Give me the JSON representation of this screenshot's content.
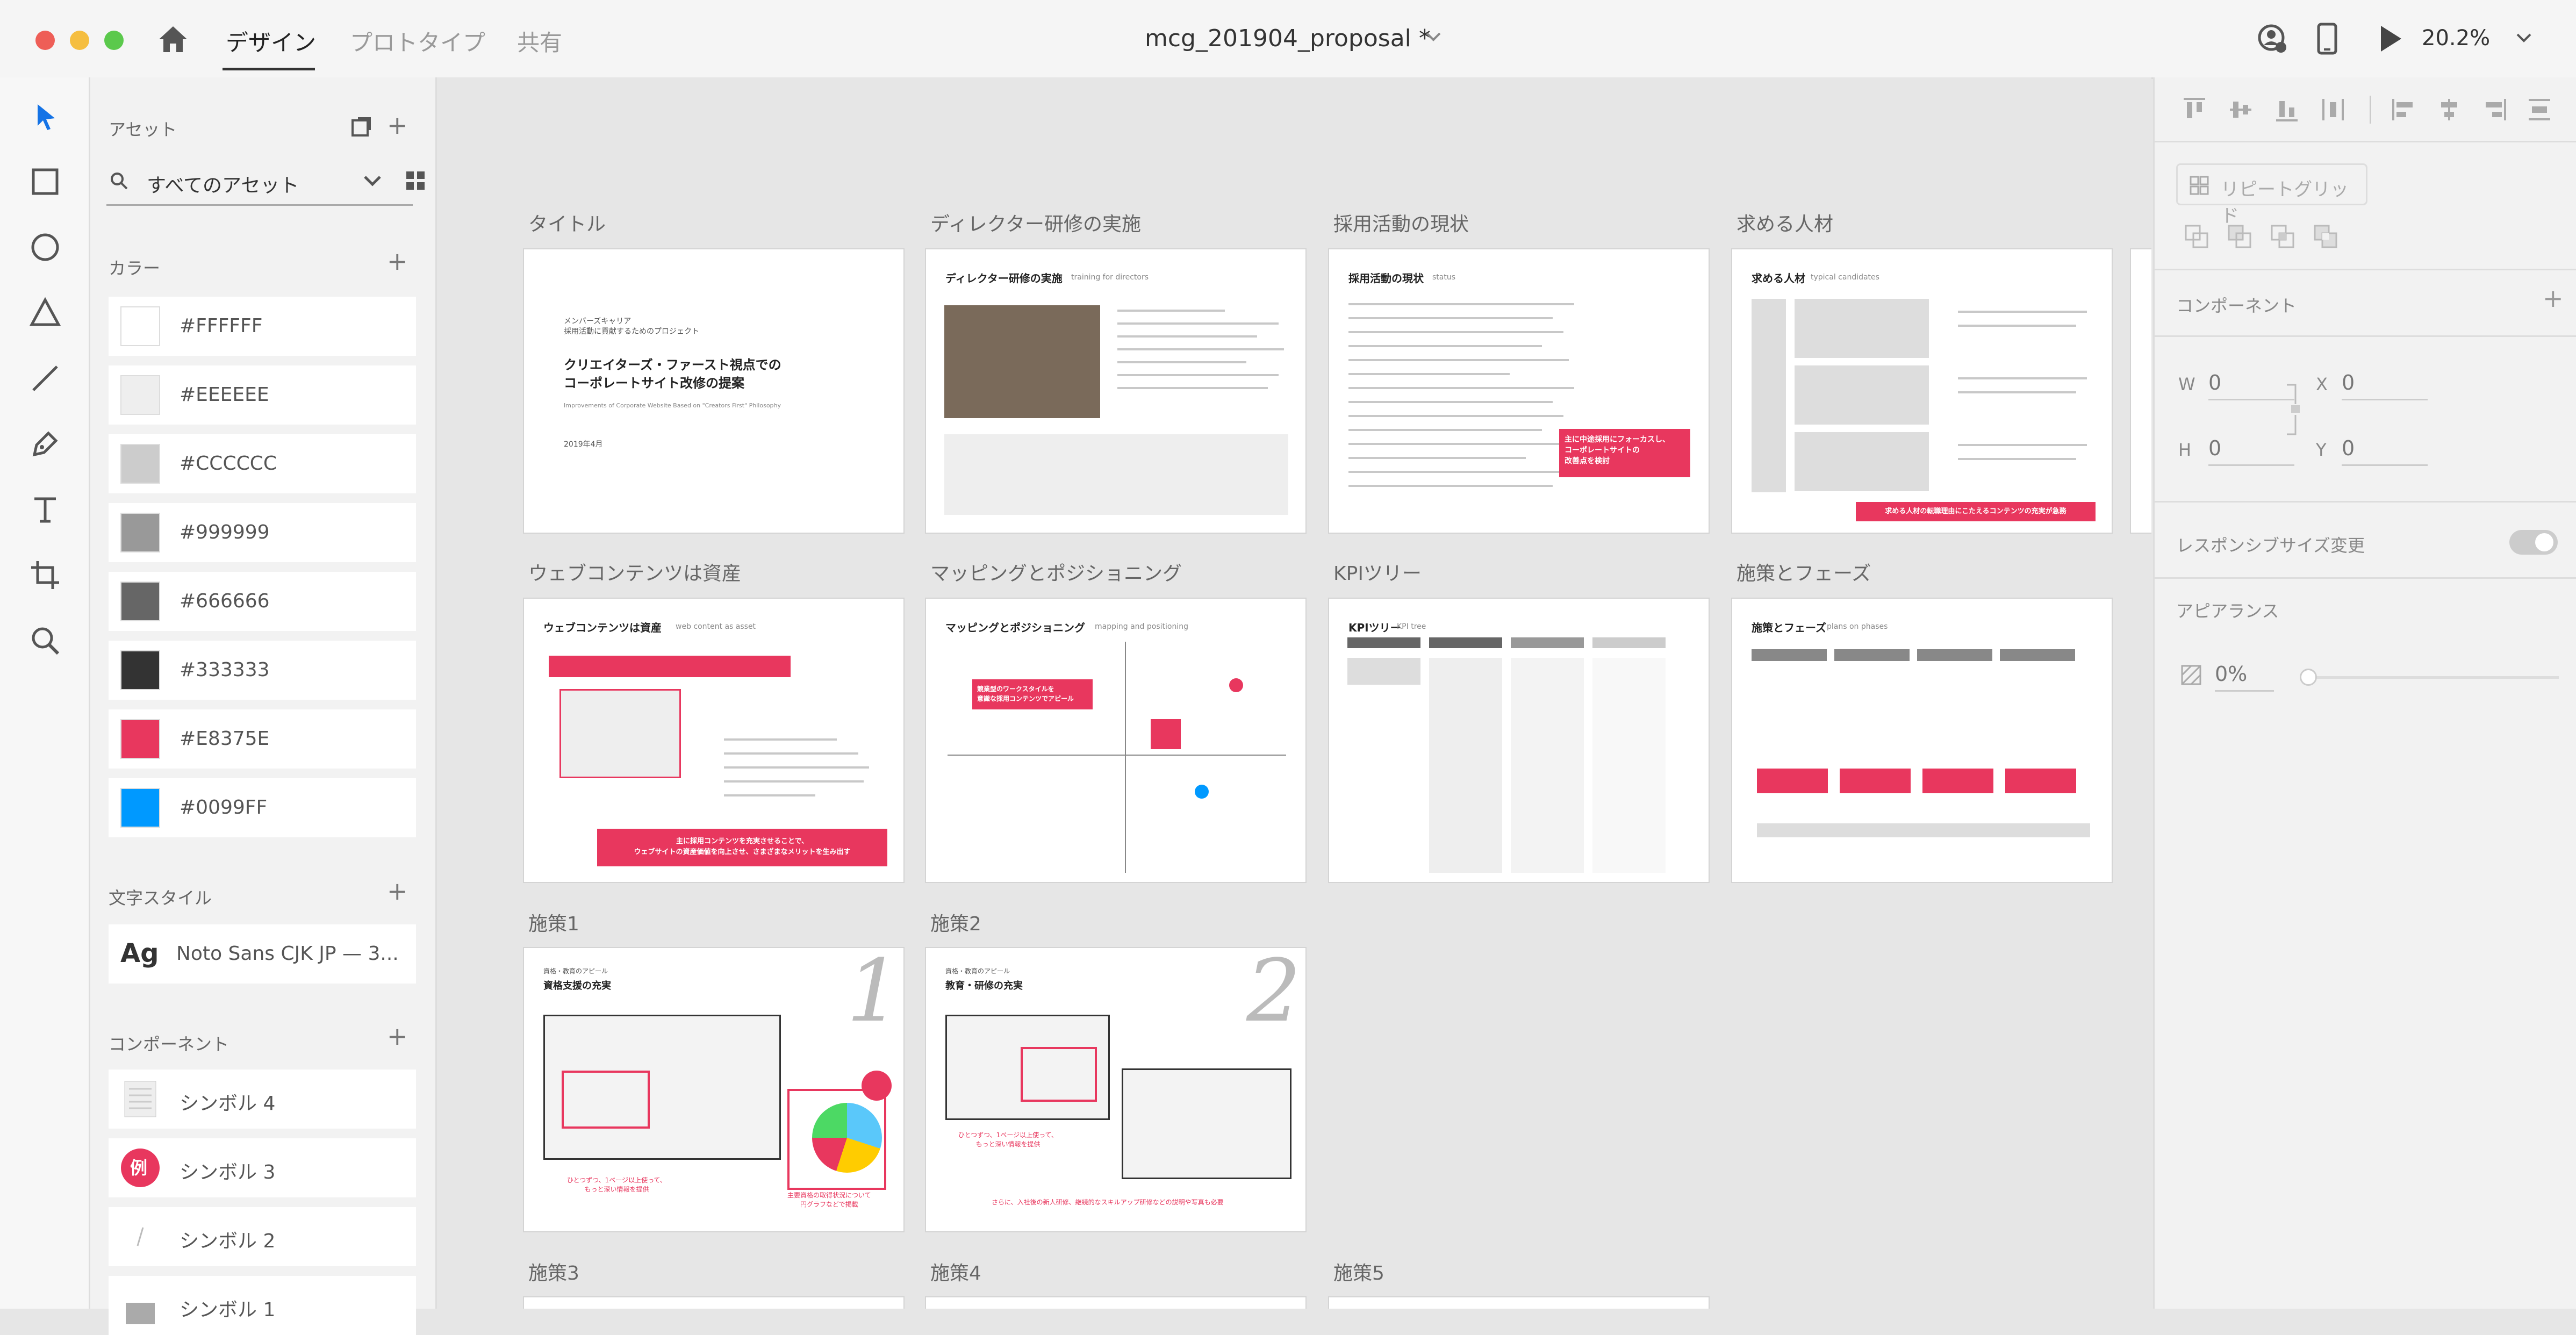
{
  "titlebar": {
    "tabs": {
      "design": "デザイン",
      "prototype": "プロトタイプ",
      "share": "共有"
    },
    "doc_title": "mcg_201904_proposal *",
    "zoom": "20.2%"
  },
  "assets": {
    "title": "アセット",
    "search": "すべてのアセット",
    "colors_title": "カラー",
    "colors": [
      {
        "hex": "#FFFFFF",
        "label": "#FFFFFF"
      },
      {
        "hex": "#EEEEEE",
        "label": "#EEEEEE"
      },
      {
        "hex": "#CCCCCC",
        "label": "#CCCCCC"
      },
      {
        "hex": "#999999",
        "label": "#999999"
      },
      {
        "hex": "#666666",
        "label": "#666666"
      },
      {
        "hex": "#333333",
        "label": "#333333"
      },
      {
        "hex": "#E8375E",
        "label": "#E8375E"
      },
      {
        "hex": "#0099FF",
        "label": "#0099FF"
      }
    ],
    "char_styles_title": "文字スタイル",
    "char_style": {
      "sample": "Ag",
      "label": "Noto Sans CJK JP — 3..."
    },
    "components_title": "コンポーネント",
    "components": [
      "シンボル 4",
      "シンボル 3",
      "シンボル 2",
      "シンボル 1"
    ],
    "symbol3_badge": "例"
  },
  "artboards": [
    {
      "label": "タイトル",
      "heading": "クリエイターズ・ファースト視点での\nコーポレートサイト改修の提案",
      "pre": "メンバーズキャリア\n採用活動に貢献するためのプロジェクト",
      "sub": "Improvements of Corporate Website Based on \"Creators First\" Philosophy",
      "date": "2019年4月"
    },
    {
      "label": "ディレクター研修の実施",
      "heading": "ディレクター研修の実施",
      "sub": "training for directors"
    },
    {
      "label": "採用活動の現状",
      "heading": "採用活動の現状",
      "sub": "status",
      "callout": "主に中途採用にフォーカスし、\nコーポレートサイトの\n改善点を検討"
    },
    {
      "label": "求める人材",
      "heading": "求める人材",
      "sub": "typical candidates",
      "footer": "求める人材の転職理由にこたえるコンテンツの充実が急務"
    },
    {
      "label": "ウェブコンテンツは資産",
      "heading": "ウェブコンテンツは資産",
      "sub": "web content as asset",
      "footer": "主に採用コンテンツを充実させることで、\nウェブサイトの資産価値を向上させ、さまざまなメリットを生み出す"
    },
    {
      "label": "マッピングとポジショニング",
      "heading": "マッピングとポジショニング",
      "sub": "mapping and positioning",
      "callout": "競業型のワークスタイルを\n意識な採用コンテンツでアピール"
    },
    {
      "label": "KPIツリー",
      "heading": "KPIツリー",
      "sub": "KPI tree"
    },
    {
      "label": "施策とフェーズ",
      "heading": "施策とフェーズ",
      "sub": "plans on phases"
    },
    {
      "label": "施策1",
      "heading": "資格支援の充実",
      "pre": "資格・教育のアピール",
      "num": "1",
      "caption": "ひとつずつ、1ページ以上使って、\nもっと深い情報を提供",
      "caption2": "主要資格の取得状況について\n円グラフなどで掲載"
    },
    {
      "label": "施策2",
      "heading": "教育・研修の充実",
      "pre": "資格・教育のアピール",
      "num": "2",
      "caption": "ひとつずつ、1ページ以上使って、\nもっと深い情報を提供",
      "caption2": "さらに、入社後の新人研修、継続的なスキルアップ研修などの説明や写真も必要"
    },
    {
      "label": "施策3"
    },
    {
      "label": "施策4"
    },
    {
      "label": "施策5"
    }
  ],
  "props": {
    "repeat_grid": "リピートグリッド",
    "component": "コンポーネント",
    "w_label": "W",
    "w": "0",
    "x_label": "X",
    "x": "0",
    "h_label": "H",
    "h": "0",
    "y_label": "Y",
    "y": "0",
    "responsive": "レスポンシブサイズ変更",
    "appearance": "アピアランス",
    "opacity": "0%"
  }
}
